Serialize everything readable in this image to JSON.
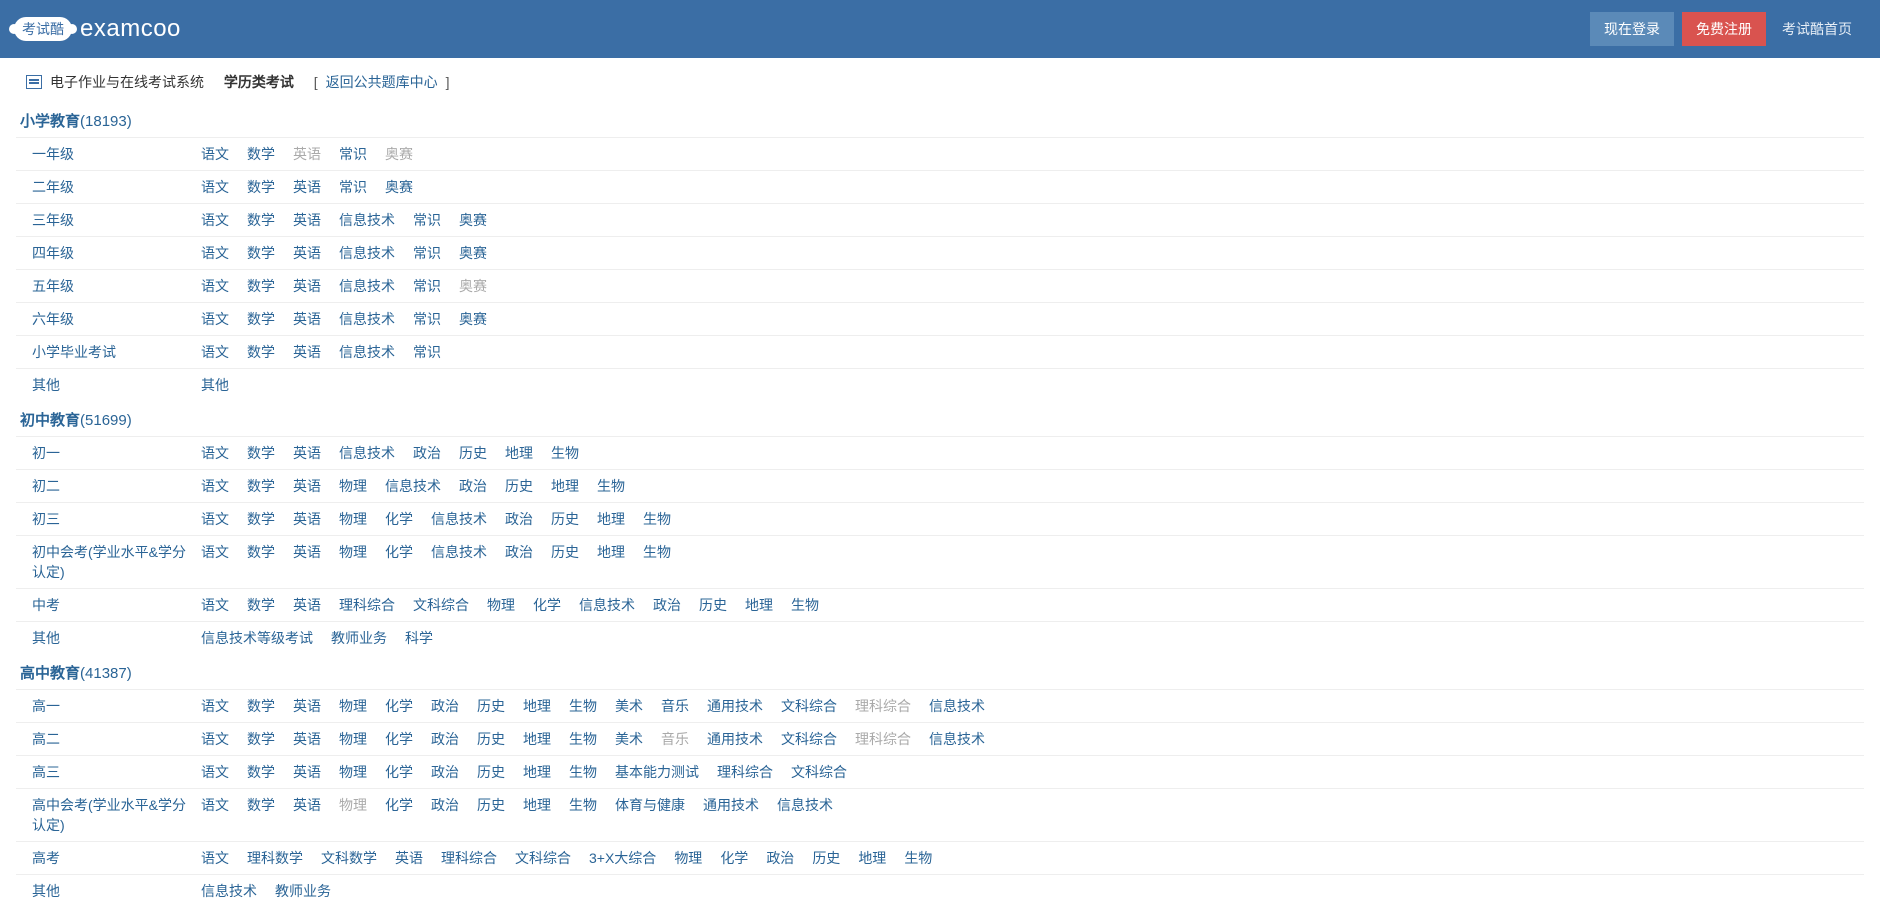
{
  "header": {
    "logo_badge": "考试酷",
    "brand": "examcoo",
    "login": "现在登录",
    "register": "免费注册",
    "home": "考试酷首页"
  },
  "crumb": {
    "system": "电子作业与在线考试系统",
    "category": "学历类考试",
    "back_label": "返回公共题库中心"
  },
  "sections": [
    {
      "title": "小学教育",
      "count": "(18193)",
      "rows": [
        {
          "label": "一年级",
          "items": [
            {
              "t": "语文"
            },
            {
              "t": "数学"
            },
            {
              "t": "英语",
              "d": true
            },
            {
              "t": "常识"
            },
            {
              "t": "奥赛",
              "d": true
            }
          ]
        },
        {
          "label": "二年级",
          "items": [
            {
              "t": "语文"
            },
            {
              "t": "数学"
            },
            {
              "t": "英语"
            },
            {
              "t": "常识"
            },
            {
              "t": "奥赛"
            }
          ]
        },
        {
          "label": "三年级",
          "items": [
            {
              "t": "语文"
            },
            {
              "t": "数学"
            },
            {
              "t": "英语"
            },
            {
              "t": "信息技术"
            },
            {
              "t": "常识"
            },
            {
              "t": "奥赛"
            }
          ]
        },
        {
          "label": "四年级",
          "items": [
            {
              "t": "语文"
            },
            {
              "t": "数学"
            },
            {
              "t": "英语"
            },
            {
              "t": "信息技术"
            },
            {
              "t": "常识"
            },
            {
              "t": "奥赛"
            }
          ]
        },
        {
          "label": "五年级",
          "items": [
            {
              "t": "语文"
            },
            {
              "t": "数学"
            },
            {
              "t": "英语"
            },
            {
              "t": "信息技术"
            },
            {
              "t": "常识"
            },
            {
              "t": "奥赛",
              "d": true
            }
          ]
        },
        {
          "label": "六年级",
          "items": [
            {
              "t": "语文"
            },
            {
              "t": "数学"
            },
            {
              "t": "英语"
            },
            {
              "t": "信息技术"
            },
            {
              "t": "常识"
            },
            {
              "t": "奥赛"
            }
          ]
        },
        {
          "label": "小学毕业考试",
          "items": [
            {
              "t": "语文"
            },
            {
              "t": "数学"
            },
            {
              "t": "英语"
            },
            {
              "t": "信息技术"
            },
            {
              "t": "常识"
            }
          ]
        },
        {
          "label": "其他",
          "items": [
            {
              "t": "其他"
            }
          ]
        }
      ]
    },
    {
      "title": "初中教育",
      "count": "(51699)",
      "rows": [
        {
          "label": "初一",
          "items": [
            {
              "t": "语文"
            },
            {
              "t": "数学"
            },
            {
              "t": "英语"
            },
            {
              "t": "信息技术"
            },
            {
              "t": "政治"
            },
            {
              "t": "历史"
            },
            {
              "t": "地理"
            },
            {
              "t": "生物"
            }
          ]
        },
        {
          "label": "初二",
          "items": [
            {
              "t": "语文"
            },
            {
              "t": "数学"
            },
            {
              "t": "英语"
            },
            {
              "t": "物理"
            },
            {
              "t": "信息技术"
            },
            {
              "t": "政治"
            },
            {
              "t": "历史"
            },
            {
              "t": "地理"
            },
            {
              "t": "生物"
            }
          ]
        },
        {
          "label": "初三",
          "items": [
            {
              "t": "语文"
            },
            {
              "t": "数学"
            },
            {
              "t": "英语"
            },
            {
              "t": "物理"
            },
            {
              "t": "化学"
            },
            {
              "t": "信息技术"
            },
            {
              "t": "政治"
            },
            {
              "t": "历史"
            },
            {
              "t": "地理"
            },
            {
              "t": "生物"
            }
          ]
        },
        {
          "label": "初中会考(学业水平&学分认定)",
          "items": [
            {
              "t": "语文"
            },
            {
              "t": "数学"
            },
            {
              "t": "英语"
            },
            {
              "t": "物理"
            },
            {
              "t": "化学"
            },
            {
              "t": "信息技术"
            },
            {
              "t": "政治"
            },
            {
              "t": "历史"
            },
            {
              "t": "地理"
            },
            {
              "t": "生物"
            }
          ]
        },
        {
          "label": "中考",
          "items": [
            {
              "t": "语文"
            },
            {
              "t": "数学"
            },
            {
              "t": "英语"
            },
            {
              "t": "理科综合"
            },
            {
              "t": "文科综合"
            },
            {
              "t": "物理"
            },
            {
              "t": "化学"
            },
            {
              "t": "信息技术"
            },
            {
              "t": "政治"
            },
            {
              "t": "历史"
            },
            {
              "t": "地理"
            },
            {
              "t": "生物"
            }
          ]
        },
        {
          "label": "其他",
          "items": [
            {
              "t": "信息技术等级考试"
            },
            {
              "t": "教师业务"
            },
            {
              "t": "科学"
            }
          ]
        }
      ]
    },
    {
      "title": "高中教育",
      "count": "(41387)",
      "rows": [
        {
          "label": "高一",
          "items": [
            {
              "t": "语文"
            },
            {
              "t": "数学"
            },
            {
              "t": "英语"
            },
            {
              "t": "物理"
            },
            {
              "t": "化学"
            },
            {
              "t": "政治"
            },
            {
              "t": "历史"
            },
            {
              "t": "地理"
            },
            {
              "t": "生物"
            },
            {
              "t": "美术"
            },
            {
              "t": "音乐"
            },
            {
              "t": "通用技术"
            },
            {
              "t": "文科综合"
            },
            {
              "t": "理科综合",
              "d": true
            },
            {
              "t": "信息技术"
            }
          ]
        },
        {
          "label": "高二",
          "items": [
            {
              "t": "语文"
            },
            {
              "t": "数学"
            },
            {
              "t": "英语"
            },
            {
              "t": "物理"
            },
            {
              "t": "化学"
            },
            {
              "t": "政治"
            },
            {
              "t": "历史"
            },
            {
              "t": "地理"
            },
            {
              "t": "生物"
            },
            {
              "t": "美术"
            },
            {
              "t": "音乐",
              "d": true
            },
            {
              "t": "通用技术"
            },
            {
              "t": "文科综合"
            },
            {
              "t": "理科综合",
              "d": true
            },
            {
              "t": "信息技术"
            }
          ]
        },
        {
          "label": "高三",
          "items": [
            {
              "t": "语文"
            },
            {
              "t": "数学"
            },
            {
              "t": "英语"
            },
            {
              "t": "物理"
            },
            {
              "t": "化学"
            },
            {
              "t": "政治"
            },
            {
              "t": "历史"
            },
            {
              "t": "地理"
            },
            {
              "t": "生物"
            },
            {
              "t": "基本能力测试"
            },
            {
              "t": "理科综合"
            },
            {
              "t": "文科综合"
            }
          ]
        },
        {
          "label": "高中会考(学业水平&学分认定)",
          "items": [
            {
              "t": "语文"
            },
            {
              "t": "数学"
            },
            {
              "t": "英语"
            },
            {
              "t": "物理",
              "d": true
            },
            {
              "t": "化学"
            },
            {
              "t": "政治"
            },
            {
              "t": "历史"
            },
            {
              "t": "地理"
            },
            {
              "t": "生物"
            },
            {
              "t": "体育与健康"
            },
            {
              "t": "通用技术"
            },
            {
              "t": "信息技术"
            }
          ]
        },
        {
          "label": "高考",
          "items": [
            {
              "t": "语文"
            },
            {
              "t": "理科数学"
            },
            {
              "t": "文科数学"
            },
            {
              "t": "英语"
            },
            {
              "t": "理科综合"
            },
            {
              "t": "文科综合"
            },
            {
              "t": "3+X大综合"
            },
            {
              "t": "物理"
            },
            {
              "t": "化学"
            },
            {
              "t": "政治"
            },
            {
              "t": "历史"
            },
            {
              "t": "地理"
            },
            {
              "t": "生物"
            }
          ]
        },
        {
          "label": "其他",
          "items": [
            {
              "t": "信息技术"
            },
            {
              "t": "教师业务"
            }
          ]
        }
      ]
    }
  ]
}
